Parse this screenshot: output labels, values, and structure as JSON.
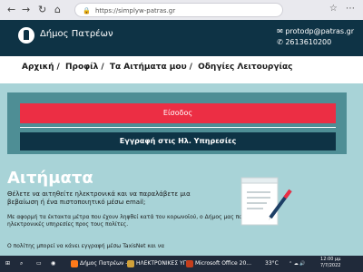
{
  "browser": {
    "url": "https://simplyw-patras.gr"
  },
  "header": {
    "site_title": "Δήμος Πατρέων",
    "email": "protodp@patras.gr",
    "phone": "2613610200"
  },
  "menu": {
    "items": [
      "Αρχική",
      "Προφίλ",
      "Τα Αιτήματα μου",
      "Οδηγίες Λειτουργίας"
    ]
  },
  "auth": {
    "login_label": "Είσοδος",
    "register_label": "Εγγραφή στις Ηλ. Υπηρεσίες"
  },
  "content": {
    "heading": "Αιτήματα",
    "para1": "Θέλετε να αιτηθείτε ηλεκτρονικά και να παραλάβετε μια βεβαίωση ή ένα πιστοποιητικό μέσω email;",
    "para2": "Με αφορμή τα έκτακτα μέτρα που έχουν ληφθεί κατά του κορωνοϊού, ο Δήμος μας παρέχει ηλεκτρονικές υπηρεσίες προς τους πολίτες.",
    "para3": "Ο πολίτης μπορεί να κάνει εγγραφή μέσω TaxisNet και να"
  },
  "taskbar": {
    "items": [
      "Δήμος Πατρέων -",
      "ΗΛΕΚΤΡΟΝΙΚΕΣ ΥΠ...",
      "Microsoft Office 20..."
    ],
    "temp": "33°C",
    "time": "12:00 μμ",
    "date": "7/7/2022"
  }
}
